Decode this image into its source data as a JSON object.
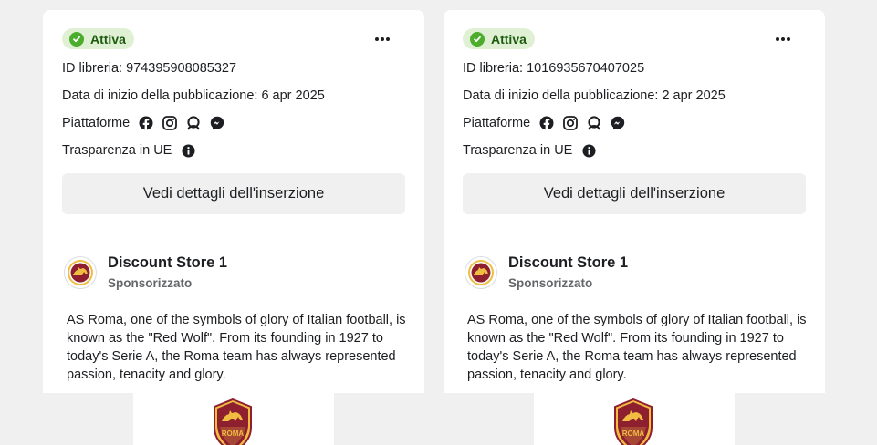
{
  "cards": [
    {
      "status": "Attiva",
      "library_id": "ID libreria: 974395908085327",
      "start_date": "Data di inizio della pubblicazione: 6 apr 2025",
      "platforms_label": "Piattaforme",
      "platforms": [
        "facebook-icon",
        "instagram-icon",
        "audience-network-icon",
        "messenger-icon"
      ],
      "eu_transparency": "Trasparenza in UE",
      "details_button": "Vedi dettagli dell'inserzione",
      "advertiser_name": "Discount Store 1",
      "advertiser_sub": "Sponsorizzato",
      "ad_text": "AS Roma, one of the symbols of glory of Italian football, is known as the \"Red Wolf\". From its founding in 1927 to today's Serie A, the Roma team has always represented passion, tenacity and glory.",
      "media_logo_text": "ROMA"
    },
    {
      "status": "Attiva",
      "library_id": "ID libreria: 1016935670407025",
      "start_date": "Data di inizio della pubblicazione: 2 apr 2025",
      "platforms_label": "Piattaforme",
      "platforms": [
        "facebook-icon",
        "instagram-icon",
        "audience-network-icon",
        "messenger-icon"
      ],
      "eu_transparency": "Trasparenza in UE",
      "details_button": "Vedi dettagli dell'inserzione",
      "advertiser_name": "Discount Store 1",
      "advertiser_sub": "Sponsorizzato",
      "ad_text": "AS Roma, one of the symbols of glory of Italian football, is known as the \"Red Wolf\". From its founding in 1927 to today's Serie A, the Roma team has always represented passion, tenacity and glory.",
      "media_logo_text": "ROMA"
    }
  ],
  "colors": {
    "active_badge_bg": "#dff0d4",
    "active_badge_text": "#1d5c10",
    "active_check": "#4bad2b",
    "roma_red": "#8e1f2f",
    "roma_yellow": "#f0bc42"
  }
}
